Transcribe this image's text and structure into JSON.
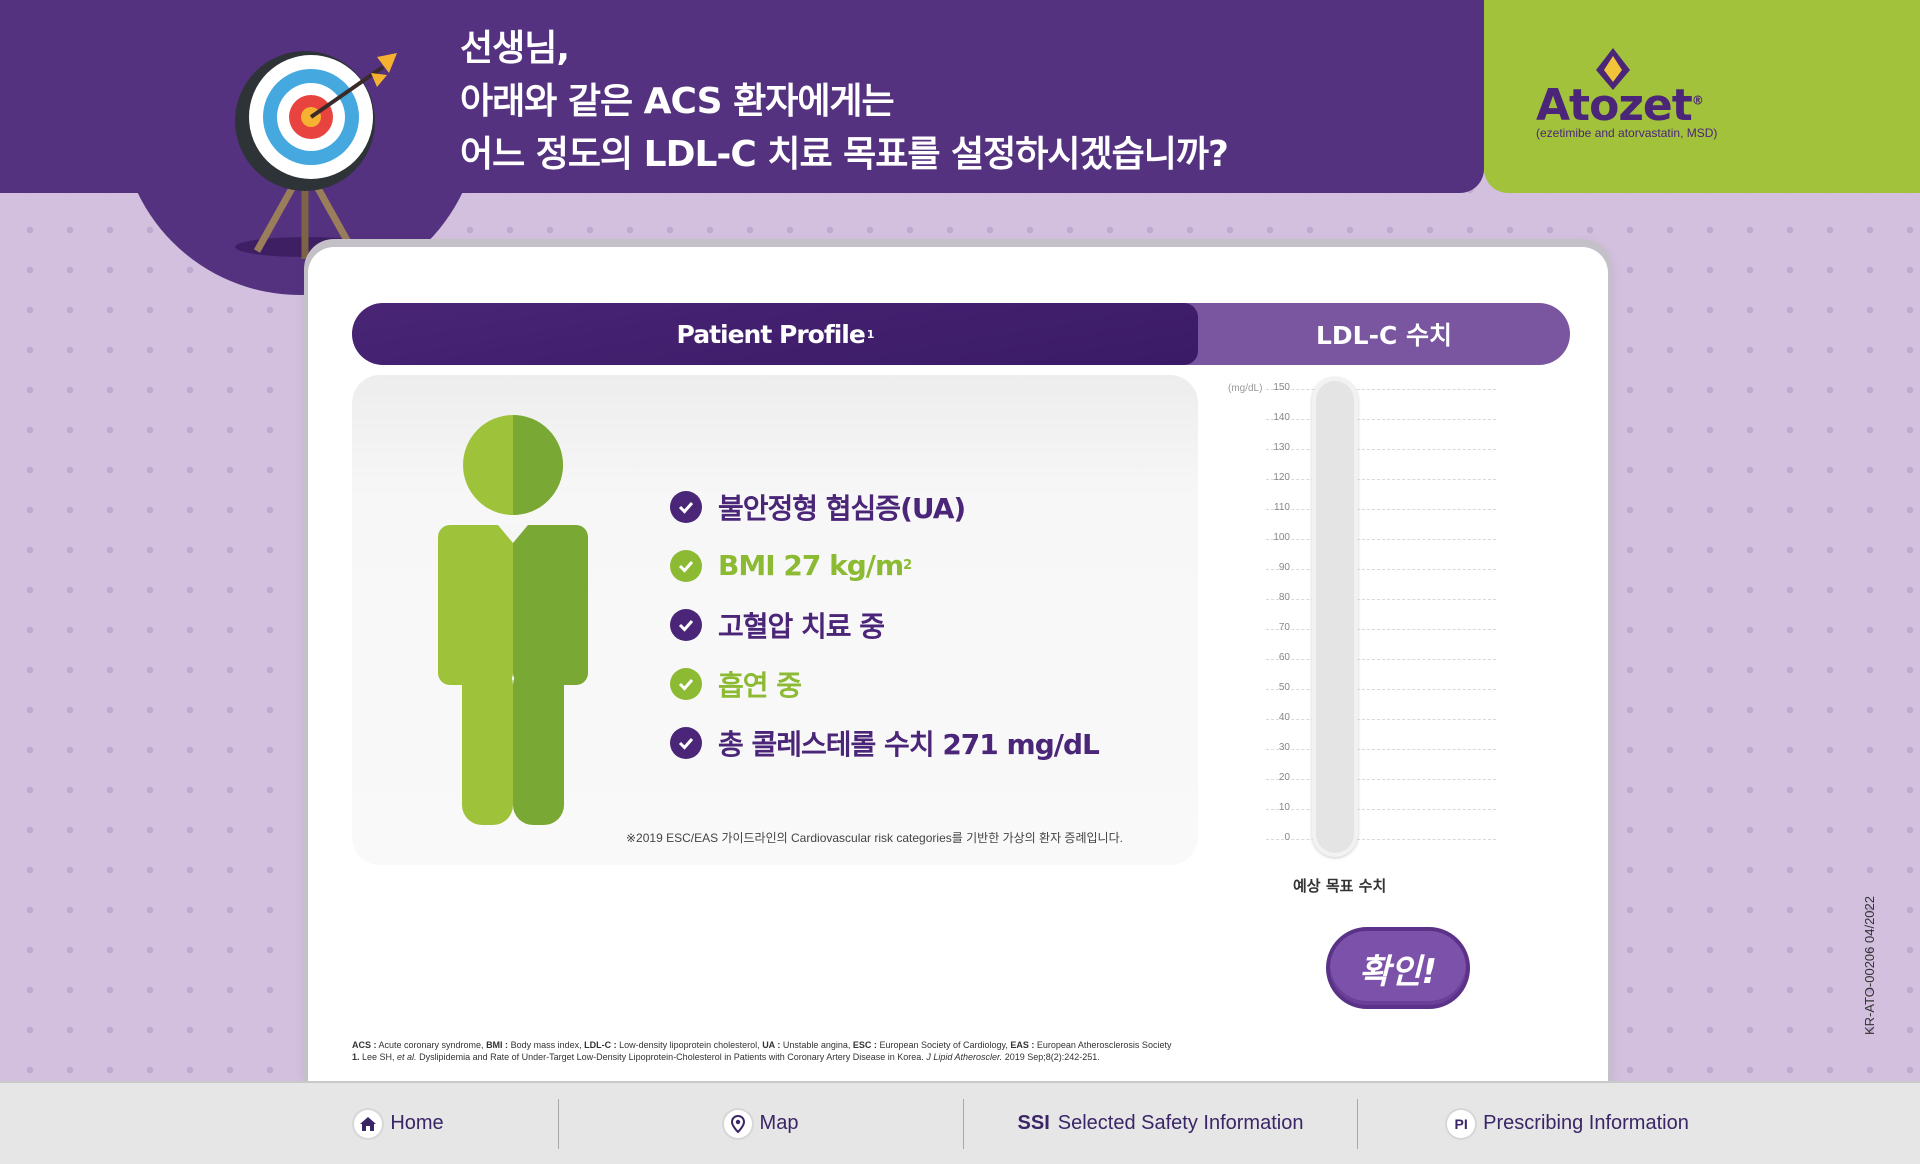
{
  "header": {
    "line1": "선생님,",
    "line2": "아래와 같은 ACS 환자에게는",
    "line3": "어느 정도의 LDL-C 치료 목표를 설정하시겠습니까?"
  },
  "brand": {
    "name": "Atozet",
    "registered": "®",
    "subtitle": "(ezetimibe and atorvastatin, MSD)"
  },
  "tabs": {
    "active_label": "Patient Profile",
    "active_ref": "1",
    "second_label": "LDL-C 수치"
  },
  "profile": {
    "items": [
      {
        "text": "불안정형 협심증(UA)",
        "color": "purple"
      },
      {
        "text": "BMI 27 kg/m",
        "sup": "2",
        "color": "green"
      },
      {
        "text": "고혈압 치료 중",
        "color": "purple"
      },
      {
        "text": "흡연 중",
        "color": "green"
      },
      {
        "text": "총 콜레스테롤 수치 271 mg/dL",
        "color": "purple"
      }
    ],
    "note": "※2019 ESC/EAS 가이드라인의 Cardiovascular risk categories를 기반한 가상의 환자 증례입니다."
  },
  "gauge": {
    "unit": "(mg/dL)",
    "ticks": [
      "150",
      "140",
      "130",
      "120",
      "110",
      "100",
      "90",
      "80",
      "70",
      "60",
      "50",
      "40",
      "30",
      "20",
      "10",
      "0"
    ],
    "range": [
      0,
      150
    ],
    "caption": "예상 목표 수치"
  },
  "confirm_label": "확인!",
  "footnotes": {
    "abbr": [
      {
        "term": "ACS :",
        "def": " Acute coronary syndrome, "
      },
      {
        "term": "BMI :",
        "def": " Body mass index, "
      },
      {
        "term": "LDL-C :",
        "def": " Low-density lipoprotein cholesterol, "
      },
      {
        "term": "UA :",
        "def": " Unstable angina, "
      },
      {
        "term": "ESC :",
        "def": " European Society of Cardiology, "
      },
      {
        "term": "EAS :",
        "def": " European Atherosclerosis Society"
      }
    ],
    "ref_num": "1.",
    "ref_author": " Lee SH, ",
    "ref_etal": "et al.",
    "ref_title": " Dyslipidemia and Rate of Under-Target Low-Density Lipoprotein-Cholesterol in Patients with Coronary Artery Disease in Korea. ",
    "ref_journal": "J Lipid Atheroscler.",
    "ref_tail": " 2019 Sep;8(2):242-251."
  },
  "doc_code": "KR-ATO-00206 04/2022",
  "nav": {
    "home": "Home",
    "map": "Map",
    "ssi_abbr": "SSI",
    "ssi": "Selected Safety Information",
    "pi_abbr": "PI",
    "pi": "Prescribing Information"
  },
  "colors": {
    "header_purple": "#54327f",
    "brand_green": "#a3c23c",
    "accent_purple": "#4a2578",
    "accent_green": "#8cba32"
  },
  "icons": [
    "target-icon",
    "check-icon",
    "person-icon",
    "home-icon",
    "map-pin-icon"
  ]
}
